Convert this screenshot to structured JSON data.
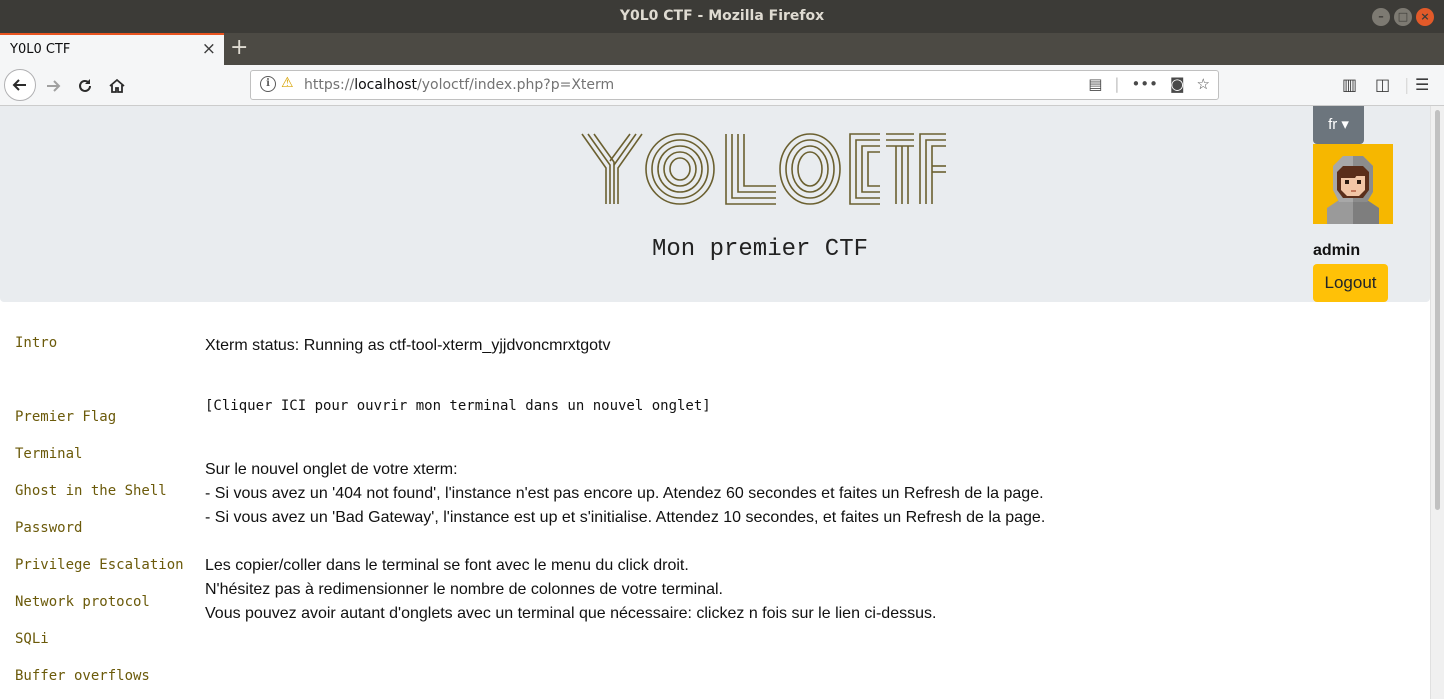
{
  "window": {
    "title": "Y0L0 CTF - Mozilla Firefox",
    "controls": [
      "–",
      "□",
      "×"
    ]
  },
  "tab": {
    "title": "Y0L0 CTF",
    "close": "×",
    "new_tab": "+"
  },
  "navbar": {
    "url_scheme": "https://",
    "url_host": "localhost",
    "url_path": "/yoloctf/index.php?p=Xterm"
  },
  "header": {
    "logo_text": "YOLO CTF",
    "subtitle": "Mon premier CTF",
    "lang_button": "fr ▾",
    "username": "admin",
    "logout_label": "Logout"
  },
  "sidebar": {
    "items": [
      {
        "label": "Intro"
      },
      {
        "label": "Premier Flag"
      },
      {
        "label": "Terminal"
      },
      {
        "label": "Ghost in the Shell"
      },
      {
        "label": "Password"
      },
      {
        "label": "Privilege Escalation"
      },
      {
        "label": "Network protocol"
      },
      {
        "label": "SQLi"
      },
      {
        "label": "Buffer overflows"
      }
    ]
  },
  "main": {
    "status": "Xterm status: Running as ctf-tool-xterm_yjjdvoncmrxtgotv",
    "terminal_link": "[Cliquer ICI pour ouvrir mon terminal dans un nouvel onglet]",
    "instructions": [
      "Sur le nouvel onglet de votre xterm:",
      "- Si vous avez un '404 not found', l'instance n'est pas encore up. Atendez 60 secondes et faites un Refresh de la page.",
      "- Si vous avez un 'Bad Gateway', l'instance est up et s'initialise. Attendez 10 secondes, et faites un Refresh de la page."
    ],
    "notes": [
      "Les copier/coller dans le terminal se font avec le menu du click droit.",
      "N'hésitez pas à redimensionner le nombre de colonnes de votre terminal.",
      "Vous pouvez avoir autant d'onglets avec un terminal que nécessaire: clickez n fois sur le lien ci-dessus."
    ]
  },
  "colors": {
    "ubuntu_orange": "#e95420",
    "jumbotron": "#e9ecef",
    "logout_yellow": "#ffc107",
    "lang_grey": "#6c757d",
    "sidebar_link": "#6b5a0a",
    "logo_stroke": "#6b6030"
  }
}
